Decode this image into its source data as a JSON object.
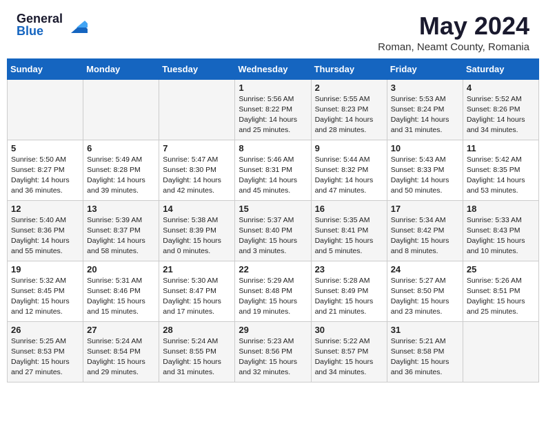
{
  "logo": {
    "general": "General",
    "blue": "Blue"
  },
  "title": "May 2024",
  "location": "Roman, Neamt County, Romania",
  "days_header": [
    "Sunday",
    "Monday",
    "Tuesday",
    "Wednesday",
    "Thursday",
    "Friday",
    "Saturday"
  ],
  "weeks": [
    [
      {
        "num": "",
        "info": ""
      },
      {
        "num": "",
        "info": ""
      },
      {
        "num": "",
        "info": ""
      },
      {
        "num": "1",
        "info": "Sunrise: 5:56 AM\nSunset: 8:22 PM\nDaylight: 14 hours\nand 25 minutes."
      },
      {
        "num": "2",
        "info": "Sunrise: 5:55 AM\nSunset: 8:23 PM\nDaylight: 14 hours\nand 28 minutes."
      },
      {
        "num": "3",
        "info": "Sunrise: 5:53 AM\nSunset: 8:24 PM\nDaylight: 14 hours\nand 31 minutes."
      },
      {
        "num": "4",
        "info": "Sunrise: 5:52 AM\nSunset: 8:26 PM\nDaylight: 14 hours\nand 34 minutes."
      }
    ],
    [
      {
        "num": "5",
        "info": "Sunrise: 5:50 AM\nSunset: 8:27 PM\nDaylight: 14 hours\nand 36 minutes."
      },
      {
        "num": "6",
        "info": "Sunrise: 5:49 AM\nSunset: 8:28 PM\nDaylight: 14 hours\nand 39 minutes."
      },
      {
        "num": "7",
        "info": "Sunrise: 5:47 AM\nSunset: 8:30 PM\nDaylight: 14 hours\nand 42 minutes."
      },
      {
        "num": "8",
        "info": "Sunrise: 5:46 AM\nSunset: 8:31 PM\nDaylight: 14 hours\nand 45 minutes."
      },
      {
        "num": "9",
        "info": "Sunrise: 5:44 AM\nSunset: 8:32 PM\nDaylight: 14 hours\nand 47 minutes."
      },
      {
        "num": "10",
        "info": "Sunrise: 5:43 AM\nSunset: 8:33 PM\nDaylight: 14 hours\nand 50 minutes."
      },
      {
        "num": "11",
        "info": "Sunrise: 5:42 AM\nSunset: 8:35 PM\nDaylight: 14 hours\nand 53 minutes."
      }
    ],
    [
      {
        "num": "12",
        "info": "Sunrise: 5:40 AM\nSunset: 8:36 PM\nDaylight: 14 hours\nand 55 minutes."
      },
      {
        "num": "13",
        "info": "Sunrise: 5:39 AM\nSunset: 8:37 PM\nDaylight: 14 hours\nand 58 minutes."
      },
      {
        "num": "14",
        "info": "Sunrise: 5:38 AM\nSunset: 8:39 PM\nDaylight: 15 hours\nand 0 minutes."
      },
      {
        "num": "15",
        "info": "Sunrise: 5:37 AM\nSunset: 8:40 PM\nDaylight: 15 hours\nand 3 minutes."
      },
      {
        "num": "16",
        "info": "Sunrise: 5:35 AM\nSunset: 8:41 PM\nDaylight: 15 hours\nand 5 minutes."
      },
      {
        "num": "17",
        "info": "Sunrise: 5:34 AM\nSunset: 8:42 PM\nDaylight: 15 hours\nand 8 minutes."
      },
      {
        "num": "18",
        "info": "Sunrise: 5:33 AM\nSunset: 8:43 PM\nDaylight: 15 hours\nand 10 minutes."
      }
    ],
    [
      {
        "num": "19",
        "info": "Sunrise: 5:32 AM\nSunset: 8:45 PM\nDaylight: 15 hours\nand 12 minutes."
      },
      {
        "num": "20",
        "info": "Sunrise: 5:31 AM\nSunset: 8:46 PM\nDaylight: 15 hours\nand 15 minutes."
      },
      {
        "num": "21",
        "info": "Sunrise: 5:30 AM\nSunset: 8:47 PM\nDaylight: 15 hours\nand 17 minutes."
      },
      {
        "num": "22",
        "info": "Sunrise: 5:29 AM\nSunset: 8:48 PM\nDaylight: 15 hours\nand 19 minutes."
      },
      {
        "num": "23",
        "info": "Sunrise: 5:28 AM\nSunset: 8:49 PM\nDaylight: 15 hours\nand 21 minutes."
      },
      {
        "num": "24",
        "info": "Sunrise: 5:27 AM\nSunset: 8:50 PM\nDaylight: 15 hours\nand 23 minutes."
      },
      {
        "num": "25",
        "info": "Sunrise: 5:26 AM\nSunset: 8:51 PM\nDaylight: 15 hours\nand 25 minutes."
      }
    ],
    [
      {
        "num": "26",
        "info": "Sunrise: 5:25 AM\nSunset: 8:53 PM\nDaylight: 15 hours\nand 27 minutes."
      },
      {
        "num": "27",
        "info": "Sunrise: 5:24 AM\nSunset: 8:54 PM\nDaylight: 15 hours\nand 29 minutes."
      },
      {
        "num": "28",
        "info": "Sunrise: 5:24 AM\nSunset: 8:55 PM\nDaylight: 15 hours\nand 31 minutes."
      },
      {
        "num": "29",
        "info": "Sunrise: 5:23 AM\nSunset: 8:56 PM\nDaylight: 15 hours\nand 32 minutes."
      },
      {
        "num": "30",
        "info": "Sunrise: 5:22 AM\nSunset: 8:57 PM\nDaylight: 15 hours\nand 34 minutes."
      },
      {
        "num": "31",
        "info": "Sunrise: 5:21 AM\nSunset: 8:58 PM\nDaylight: 15 hours\nand 36 minutes."
      },
      {
        "num": "",
        "info": ""
      }
    ]
  ]
}
